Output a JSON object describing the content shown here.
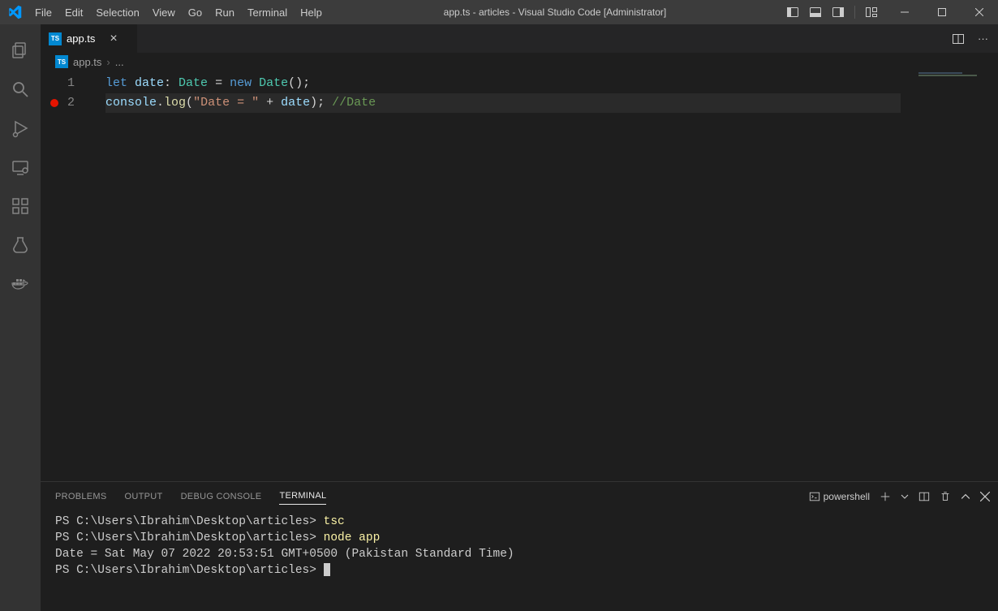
{
  "window": {
    "title": "app.ts - articles - Visual Studio Code [Administrator]"
  },
  "menubar": {
    "items": [
      "File",
      "Edit",
      "Selection",
      "View",
      "Go",
      "Run",
      "Terminal",
      "Help"
    ]
  },
  "tabs": {
    "open": [
      {
        "filename": "app.ts",
        "icon": "ts"
      }
    ]
  },
  "breadcrumb": {
    "filename": "app.ts",
    "sep": "›",
    "trailing": "..."
  },
  "editor": {
    "lines": [
      {
        "num": "1",
        "breakpoint": false,
        "tokens": [
          {
            "t": "let ",
            "c": "tok-kw"
          },
          {
            "t": "date",
            "c": "tok-var"
          },
          {
            "t": ": ",
            "c": "tok-plain"
          },
          {
            "t": "Date",
            "c": "tok-type"
          },
          {
            "t": " = ",
            "c": "tok-plain"
          },
          {
            "t": "new ",
            "c": "tok-kw"
          },
          {
            "t": "Date",
            "c": "tok-type"
          },
          {
            "t": "();",
            "c": "tok-plain"
          }
        ]
      },
      {
        "num": "2",
        "breakpoint": true,
        "current": true,
        "tokens": [
          {
            "t": "console",
            "c": "tok-var"
          },
          {
            "t": ".",
            "c": "tok-plain"
          },
          {
            "t": "log",
            "c": "tok-fn"
          },
          {
            "t": "(",
            "c": "tok-plain"
          },
          {
            "t": "\"Date = \"",
            "c": "tok-str"
          },
          {
            "t": " + ",
            "c": "tok-plain"
          },
          {
            "t": "date",
            "c": "tok-var"
          },
          {
            "t": "); ",
            "c": "tok-plain"
          },
          {
            "t": "//Date",
            "c": "tok-com"
          }
        ]
      }
    ]
  },
  "panel": {
    "tabs": [
      "PROBLEMS",
      "OUTPUT",
      "DEBUG CONSOLE",
      "TERMINAL"
    ],
    "active": "TERMINAL",
    "shell": "powershell"
  },
  "terminal": {
    "lines": [
      {
        "prompt": "PS C:\\Users\\Ibrahim\\Desktop\\articles> ",
        "cmd": "tsc"
      },
      {
        "prompt": "PS C:\\Users\\Ibrahim\\Desktop\\articles> ",
        "cmd": "node app"
      },
      {
        "text": "Date = Sat May 07 2022 20:53:51 GMT+0500 (Pakistan Standard Time)"
      },
      {
        "prompt": "PS C:\\Users\\Ibrahim\\Desktop\\articles> ",
        "cursor": true
      }
    ]
  }
}
